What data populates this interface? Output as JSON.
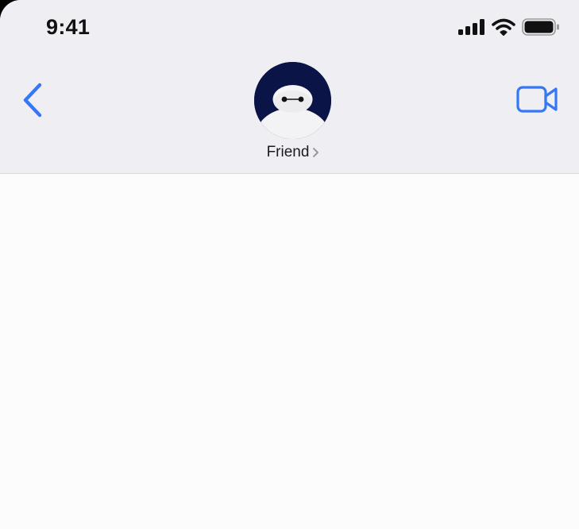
{
  "status_bar": {
    "time": "9:41",
    "icons": [
      "cellular-signal-icon",
      "wifi-icon",
      "battery-icon"
    ]
  },
  "nav": {
    "back_icon": "chevron-left-icon",
    "video_icon": "video-camera-icon",
    "contact": {
      "name": "Friend",
      "avatar": "baymax-avatar",
      "disclosure_icon": "chevron-right-icon"
    }
  },
  "colors": {
    "accent": "#3478f6",
    "header_bg": "#efeff3",
    "chat_bg": "#fdfcfd",
    "avatar_bg": "#0a1446"
  },
  "chat": {
    "messages": []
  }
}
